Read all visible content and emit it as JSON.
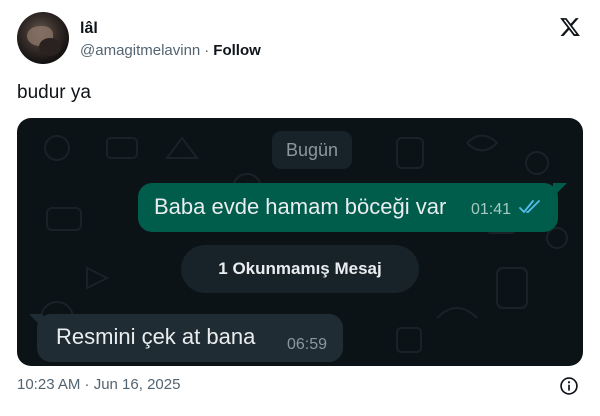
{
  "author": {
    "name": "lâl",
    "handle": "@amagitmelavinn",
    "separator": "·",
    "follow_label": "Follow"
  },
  "brand_icon": "x-logo-icon",
  "tweet_text": "budur ya",
  "chat": {
    "date_chip": "Bugün",
    "outgoing": {
      "text": "Baba evde hamam böceği var",
      "time": "01:41",
      "status_icon": "double-check-icon",
      "status": "read"
    },
    "unread_label": "1 Okunmamış Mesaj",
    "incoming": {
      "text": "Resmini çek at bana",
      "time": "06:59"
    }
  },
  "footer": {
    "timestamp": "10:23 AM · Jun 16, 2025",
    "info_icon": "info-icon"
  },
  "colors": {
    "chat_bg": "#0c1317",
    "outgoing_bubble": "#005c4b",
    "incoming_bubble": "#202c33",
    "chip_bg": "#182229",
    "read_ticks": "#53bdeb",
    "muted_text": "#536471"
  }
}
